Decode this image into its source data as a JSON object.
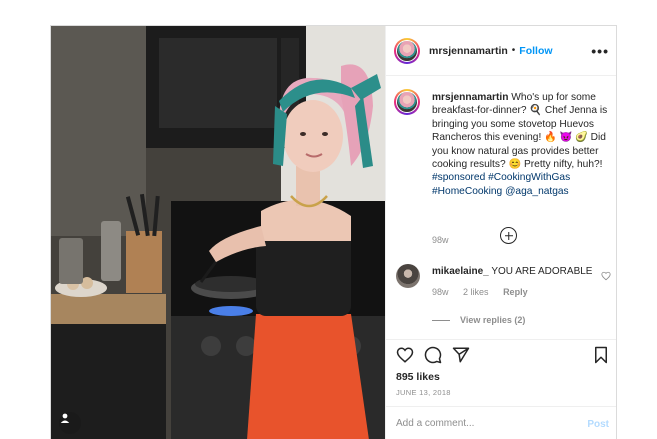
{
  "post": {
    "username": "mrsjennamartin",
    "separator": "•",
    "follow_label": "Follow",
    "more_icon": "more-horizontal-icon",
    "more_glyph": "•••"
  },
  "caption": {
    "username": "mrsjennamartin",
    "text": "Who's up for some breakfast-for-dinner? 🍳 Chef Jenna is bringing you some stovetop Huevos Rancheros this evening! 🔥 😈 🥑 Did you know natural gas provides better cooking results? 😊 Pretty nifty, huh?!",
    "hashtags": [
      "#sponsored",
      "#CookingWithGas",
      "#HomeCooking",
      "@aga_natgas"
    ],
    "age": "98w"
  },
  "comment": {
    "username": "mikaelaine_",
    "text": "YOU ARE ADORABLE",
    "age": "98w",
    "likes": "2 likes",
    "reply_label": "Reply",
    "view_replies": "View replies (2)"
  },
  "stats": {
    "likes": "895 likes",
    "date": "JUNE 13, 2018"
  },
  "add_comment": {
    "placeholder": "Add a comment...",
    "post_label": "Post"
  },
  "colors": {
    "link_blue": "#0095f6",
    "hashtag": "#00376b",
    "muted": "#8e8e8e",
    "post_disabled": "#b3dbff"
  }
}
